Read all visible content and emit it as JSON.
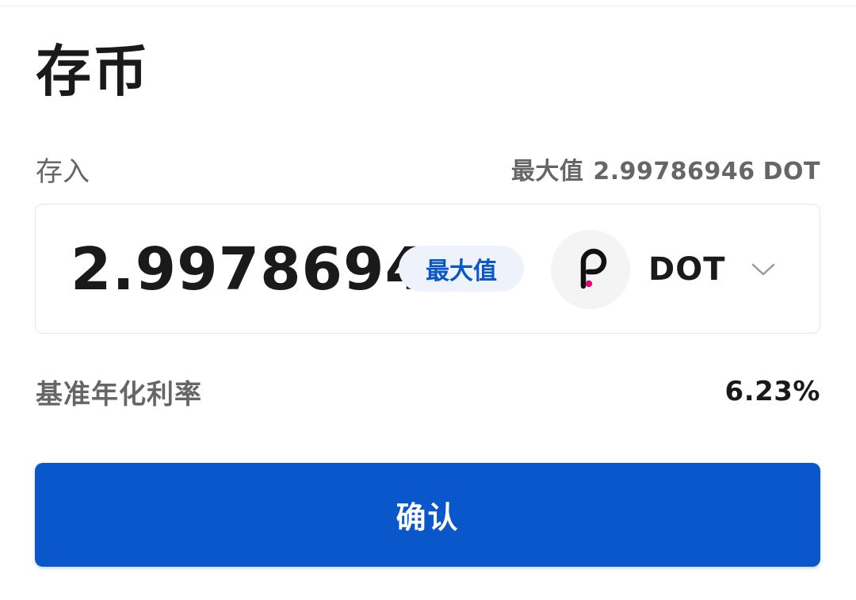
{
  "page": {
    "title": "存币"
  },
  "deposit": {
    "label": "存入",
    "max_hint_label": "最大值",
    "max_hint_value": "2.99786946",
    "max_hint_unit": "DOT",
    "amount": "2.9978694",
    "max_button_label": "最大值"
  },
  "token": {
    "symbol": "DOT",
    "icon": "polkadot-logo-icon",
    "accent_color": "#e6007a"
  },
  "apr": {
    "label": "基准年化利率",
    "value": "6.23%"
  },
  "confirm": {
    "label": "确认",
    "color": "#0a57cc"
  }
}
